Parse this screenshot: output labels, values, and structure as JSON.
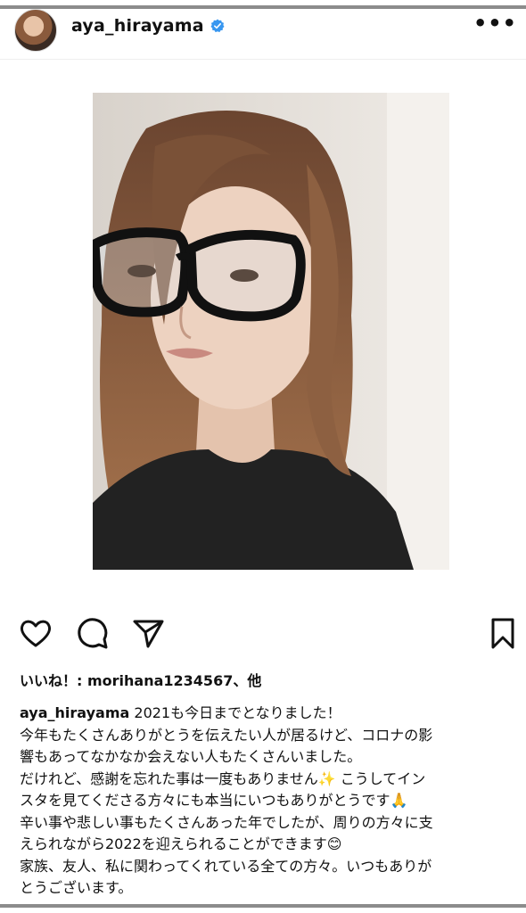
{
  "post": {
    "username": "aya_hirayama",
    "likes_label": "いいね！: ",
    "likes_user": "morihana1234567",
    "likes_suffix": "、他",
    "caption_first": " 2021も今日までとなりました！",
    "caption_lines": [
      "今年もたくさんありがとうを伝えたい人が居るけど、コロナの影",
      "響もあってなかなか会えない人もたくさんいました。",
      "だけれど、感謝を忘れた事は一度もありません✨ こうしてイン",
      "スタを見てくださる方々にも本当にいつもありがとうです🙏",
      "辛い事や悲しい事もたくさんあった年でしたが、周りの方々に支",
      "えられながら2022を迎えられることができます😊",
      "家族、友人、私に関わってくれている全ての方々。いつもありが",
      "とうございます。"
    ]
  },
  "icons": {
    "like": "heart-icon",
    "comment": "comment-icon",
    "share": "send-icon",
    "save": "bookmark-icon",
    "more": "more-dots-icon",
    "verified": "verified-badge-icon"
  },
  "colors": {
    "verified": "#3897f0",
    "text": "#111111"
  }
}
